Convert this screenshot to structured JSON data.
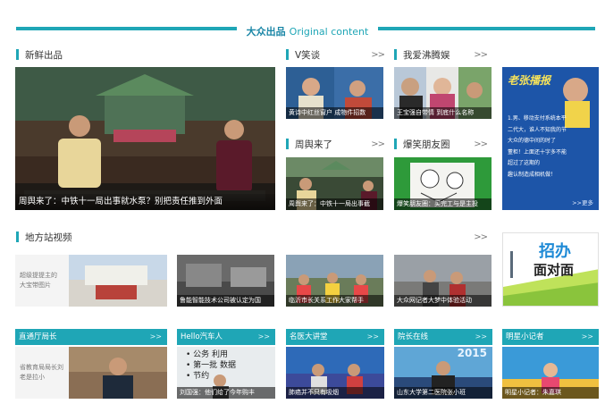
{
  "header": {
    "title_cn": "大众出品",
    "title_en": "Original content"
  },
  "sections": {
    "fresh": {
      "label": "新鲜出品"
    },
    "vxiaotan": {
      "label": "V笑谈",
      "more": ">>"
    },
    "woai": {
      "label": "我爱沸腾娱",
      "more": ">>"
    },
    "zhouyu": {
      "label": "周舆来了",
      "more": ">>"
    },
    "baoxiao": {
      "label": "爆笑朋友圈",
      "more": ">>"
    },
    "difang": {
      "label": "地方站视频",
      "more": ">>"
    }
  },
  "main_video": {
    "caption": "周舆来了：中铁十一局出事就水泵？别把责任推到外面"
  },
  "row1": [
    {
      "caption": "黄诗中红丝窗户 成物件招数"
    },
    {
      "caption": "王宝强自带情 到底什么名称"
    }
  ],
  "row2": [
    {
      "caption": "周舆来了：中铁十一局出事截"
    },
    {
      "caption": "爆笑朋友圈：买完工与是主投"
    }
  ],
  "poster": {
    "title": "老张播报",
    "lines": [
      "1.男、移动支付系统本平",
      "二代大，谁人不知我的节",
      "大众的德中间的时了",
      "董柜！上面还十字多不能",
      "超过了这期的",
      "趣认制造成相机做！"
    ],
    "more": ">>更多"
  },
  "local": [
    {
      "caption": "",
      "side_text": "超级提提主的大宝带图片"
    },
    {
      "caption": "鲁能智能技术公司被认定为国"
    },
    {
      "caption": "临沂市长关系工作大家帮手"
    },
    {
      "caption": "大众网记者大梦中体验活动"
    }
  ],
  "zhaoban": {
    "line1": "招办",
    "line2": "面对面"
  },
  "bottom": [
    {
      "title": "直通厅局长",
      "more": ">>",
      "caption": "",
      "side_text": "省教育局局长刘老是拉小"
    },
    {
      "title": "Hello汽车人",
      "more": ">>",
      "caption": "刘国强：他们给了今年购丰",
      "board_lines": [
        "• 公务 利用",
        "• 第一批 数据",
        "• 节约"
      ]
    },
    {
      "title": "名医大讲堂",
      "more": ">>",
      "caption": "肺癌并不只有吸烟"
    },
    {
      "title": "院长在线",
      "more": ">>",
      "caption": "山东大学第二医院张小班",
      "bg_text": "2015"
    },
    {
      "title": "明星小记者",
      "more": ">>",
      "caption": "明星小记者：朱嘉琪"
    }
  ],
  "colors": {
    "accent": "#1fa6b6"
  }
}
